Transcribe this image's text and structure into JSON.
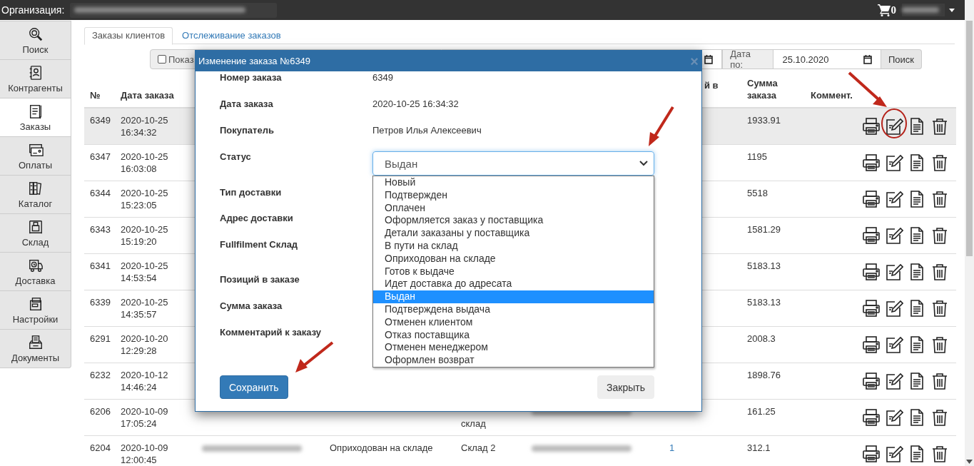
{
  "topbar": {
    "org_label": "Организация:",
    "cart_count": "0"
  },
  "sidebar": {
    "items": [
      {
        "label": "Поиск",
        "kind": "search",
        "selected": false
      },
      {
        "label": "Контрагенты",
        "kind": "contacts",
        "selected": false
      },
      {
        "label": "Заказы",
        "kind": "orders",
        "selected": true
      },
      {
        "label": "Оплаты",
        "kind": "payments",
        "selected": false
      },
      {
        "label": "Каталог",
        "kind": "catalog",
        "selected": false
      },
      {
        "label": "Склад",
        "kind": "warehouse",
        "selected": false
      },
      {
        "label": "Доставка",
        "kind": "delivery",
        "selected": false
      },
      {
        "label": "Настройки",
        "kind": "settings",
        "selected": false
      },
      {
        "label": "Документы",
        "kind": "documents",
        "selected": false
      }
    ]
  },
  "tabs": [
    {
      "label": "Заказы клиентов",
      "selected": true
    },
    {
      "label": "Отслеживание заказов",
      "selected": false
    }
  ],
  "filters": {
    "checkbox_label": "Показ",
    "checked": false,
    "date_to_label": "Дата по:",
    "date_to_value": "25.10.2020",
    "search_button": "Поиск"
  },
  "table": {
    "columns": [
      {
        "kind": "num",
        "label": "№"
      },
      {
        "kind": "date",
        "label": "Дата заказа"
      },
      {
        "kind": "positions",
        "label": "й в"
      },
      {
        "kind": "sum",
        "label": "Сумма заказа"
      },
      {
        "kind": "comment",
        "label": "Коммент."
      }
    ],
    "rows": [
      {
        "num": "6349",
        "date": "2020-10-25 16:34:32",
        "sum": "1933.91",
        "selected": true
      },
      {
        "num": "6347",
        "date": "2020-10-25 16:03:08",
        "sum": "1195",
        "selected": false
      },
      {
        "num": "6344",
        "date": "2020-10-25 15:23:05",
        "sum": "5518",
        "selected": false
      },
      {
        "num": "6343",
        "date": "2020-10-25 15:19:20",
        "sum": "1581.29",
        "selected": false
      },
      {
        "num": "6341",
        "date": "2020-10-25 14:53:54",
        "sum": "5183.13",
        "selected": false
      },
      {
        "num": "6339",
        "date": "2020-10-25 14:35:57",
        "sum": "5183.13",
        "selected": false
      },
      {
        "num": "6291",
        "date": "2020-10-20 12:29:28",
        "sum": "2008.3",
        "selected": false
      },
      {
        "num": "6232",
        "date": "2020-10-12 14:46:24",
        "sum": "1898.76",
        "selected": false
      },
      {
        "num": "6206",
        "date": "2020-10-09 17:05:24",
        "warehouse": "склад",
        "address_redacted": true,
        "sum": "161.25",
        "selected": false
      },
      {
        "num": "6204",
        "date": "2020-10-09 12:00:45",
        "customer_redacted": true,
        "status": "Оприходован на складе",
        "warehouse": "Склад 2",
        "address_redacted": true,
        "positions": "1",
        "sum": "312.1",
        "selected": false
      }
    ]
  },
  "modal": {
    "title": "Изменение заказа №6349",
    "close": "×",
    "fields": [
      {
        "kind": "text",
        "label": "Номер заказа",
        "value": "6349"
      },
      {
        "kind": "text",
        "label": "Дата заказа",
        "value": "2020-10-25 16:34:32"
      },
      {
        "kind": "text",
        "label": "Покупатель",
        "value": "Петров Илья Алексеевич"
      },
      {
        "kind": "select",
        "label": "Статус",
        "value": "Выдан",
        "expanded": true,
        "options": [
          {
            "label": "Новый",
            "selected": false
          },
          {
            "label": "Подтвержден",
            "selected": false
          },
          {
            "label": "Оплачен",
            "selected": false
          },
          {
            "label": "Оформляется заказ у поставщика",
            "selected": false
          },
          {
            "label": "Детали заказаны у поставщика",
            "selected": false
          },
          {
            "label": "В пути на склад",
            "selected": false
          },
          {
            "label": "Оприходован на складе",
            "selected": false
          },
          {
            "label": "Готов к выдаче",
            "selected": false
          },
          {
            "label": "Идет доставка до адресата",
            "selected": false
          },
          {
            "label": "Выдан",
            "selected": true
          },
          {
            "label": "Подтверждена выдача",
            "selected": false
          },
          {
            "label": "Отменен клиентом",
            "selected": false
          },
          {
            "label": "Отказ поставщика",
            "selected": false
          },
          {
            "label": "Отменен менеджером",
            "selected": false
          },
          {
            "label": "Оформлен возврат",
            "selected": false
          }
        ]
      },
      {
        "kind": "label",
        "label": "Тип доставки"
      },
      {
        "kind": "label",
        "label": "Адрес доставки"
      },
      {
        "kind": "label",
        "label": "Fullfilment Склад"
      },
      {
        "kind": "label",
        "label": "Позиций в заказе"
      },
      {
        "kind": "label",
        "label": "Сумма заказа"
      },
      {
        "kind": "label",
        "label": "Комментарий к заказу"
      }
    ],
    "save_button": "Сохранить",
    "close_button": "Закрыть"
  }
}
